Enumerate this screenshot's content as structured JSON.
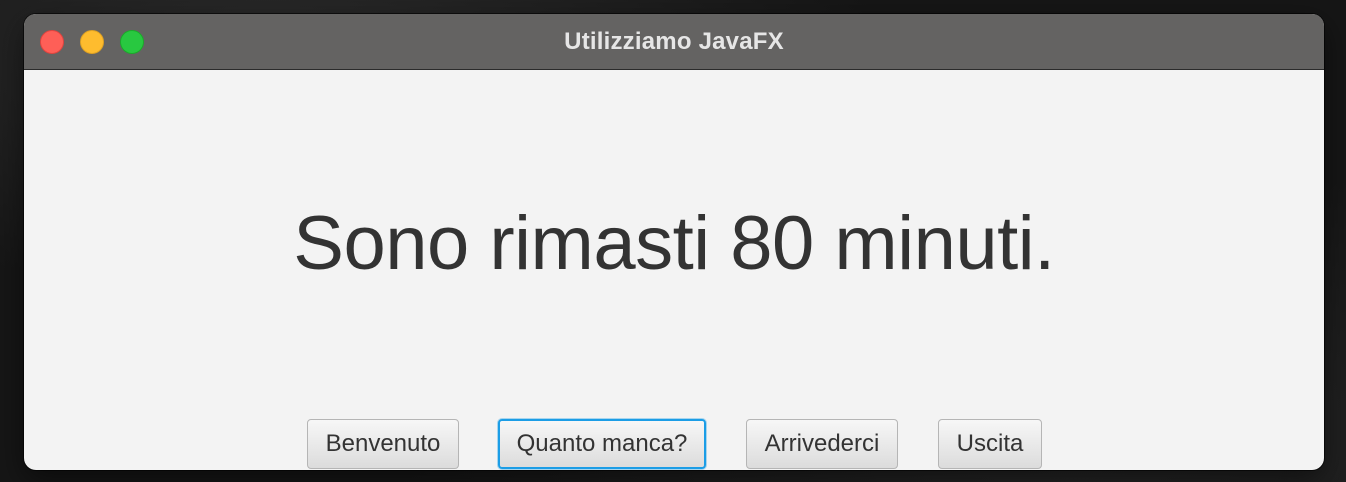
{
  "window": {
    "title": "Utilizziamo JavaFX"
  },
  "main": {
    "message": "Sono rimasti 80 minuti."
  },
  "buttons": {
    "benvenuto": "Benvenuto",
    "quanto_manca": "Quanto manca?",
    "arrivederci": "Arrivederci",
    "uscita": "Uscita",
    "focused": "quanto_manca"
  },
  "colors": {
    "titlebar": "#646362",
    "content_background": "#f3f3f3",
    "text": "#333333",
    "focus_ring": "#1b9de6",
    "close": "#fe5f57",
    "minimize": "#febc2e",
    "zoom": "#28c840"
  }
}
